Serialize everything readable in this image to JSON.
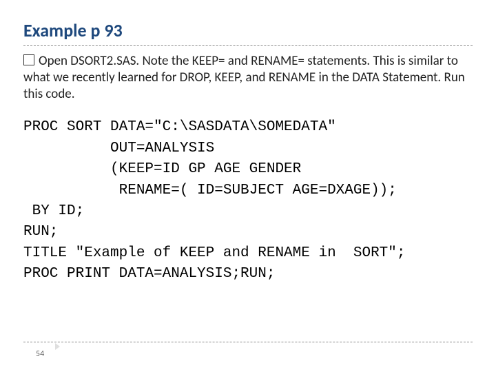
{
  "title": "Example p 93",
  "bullet": {
    "lead": "Open DSORT2.SAS. Note the KEEP= and RENAME= statements. This is similar to what we recently learned for DROP, KEEP, and RENAME in the DATA Statement. Run this code."
  },
  "code": {
    "l1": "PROC SORT DATA=\"C:\\SASDATA\\SOMEDATA\"",
    "l2": "          OUT=ANALYSIS",
    "l3": "          (KEEP=ID GP AGE GENDER",
    "l4": "           RENAME=( ID=SUBJECT AGE=DXAGE));",
    "l5": " BY ID;",
    "l6": "RUN;",
    "l7": "TITLE \"Example of KEEP and RENAME in  SORT\";",
    "l8": "PROC PRINT DATA=ANALYSIS;RUN;"
  },
  "page": "54"
}
